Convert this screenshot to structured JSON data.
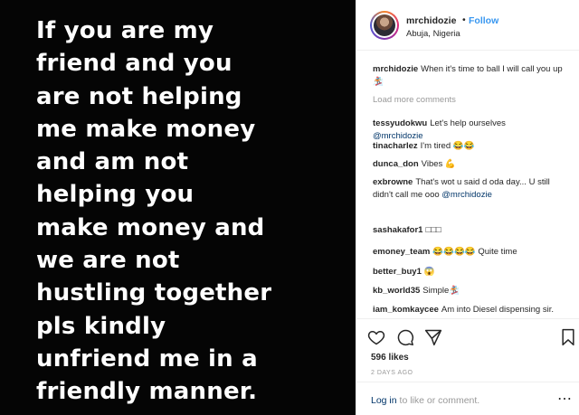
{
  "post": {
    "text_lines": [
      "If you are my",
      "friend and you",
      "are not helping",
      "me make money",
      "and am not",
      "helping you",
      "make money and",
      "we are not",
      "hustling together",
      "pls kindly",
      "unfriend me in a",
      "friendly manner."
    ]
  },
  "header": {
    "username": "mrchidozie",
    "dot": "•",
    "follow_label": "Follow",
    "location": "Abuja, Nigeria"
  },
  "caption": {
    "user": "mrchidozie",
    "text": "When it's time to ball I will call you up🏂"
  },
  "load_more_label": "Load more comments",
  "comments": [
    {
      "user": "tessyudokwu",
      "text": "Let's help ourselves",
      "mention": "@mrchidozie",
      "mention_on_new_line": true
    },
    {
      "user": "tinacharlez",
      "text": "I'm tired 😂😂"
    },
    {
      "user": "dunca_don",
      "text": "Vibes 💪"
    },
    {
      "user": "exbrowne",
      "text": "That's wot u said d oda day... U still didn't call me ooo",
      "mention": "@mrchidozie"
    },
    {
      "user": "sashakafor1",
      "text": "□□□"
    },
    {
      "user": "emoney_team",
      "text": "😂😂😂😂 Quite time"
    },
    {
      "user": "better_buy1",
      "text": "😱"
    },
    {
      "user": "kb_world35",
      "text": "Simple🏂"
    },
    {
      "user": "iam_komkaycee",
      "text": "Am into Diesel dispensing sir. please,just need some link to friends who needs diesel. I dispense diesel to doorstep sir with any litres like 1000"
    }
  ],
  "actions": {
    "icons": [
      "heart-icon",
      "comment-icon",
      "share-icon",
      "save-icon"
    ],
    "likes": "596 likes",
    "time_ago": "2 DAYS AGO"
  },
  "footer": {
    "login_link": "Log in",
    "login_rest": " to like or comment.",
    "more_icon": "⋯"
  },
  "colors": {
    "link_blue": "#3897f0",
    "mention_blue": "#003569",
    "muted_gray": "#999999",
    "text_dark": "#262626"
  }
}
